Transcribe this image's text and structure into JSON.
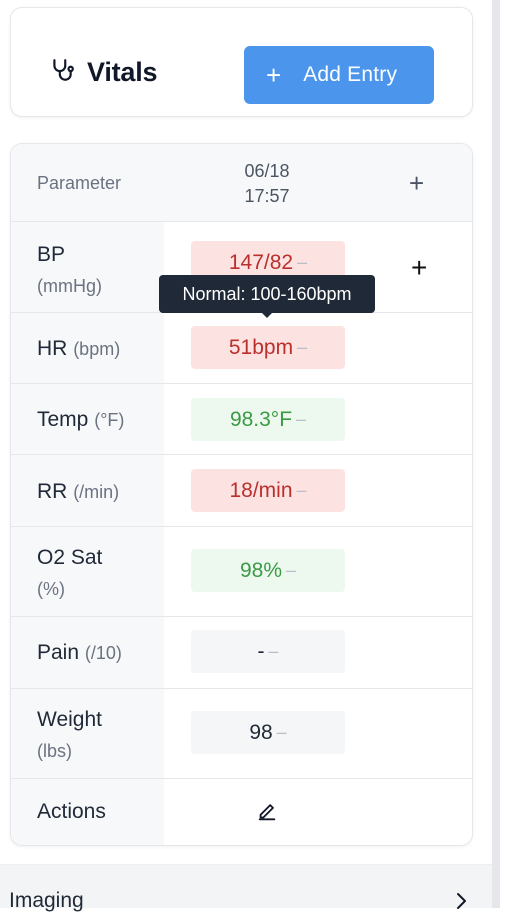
{
  "header": {
    "title": "Vitals",
    "icon": "stethoscope-icon",
    "add_button": {
      "plus": "+",
      "label": "Add Entry"
    }
  },
  "table": {
    "header": {
      "parameter": "Parameter",
      "date": "06/18",
      "time": "17:57",
      "add_column": "+"
    },
    "rows": [
      {
        "name": "BP",
        "unit": "(mmHg)",
        "value": "147/82",
        "status": "abnormal",
        "dash": "–",
        "action": "+"
      },
      {
        "name": "HR",
        "unit": "(bpm)",
        "value": "51bpm",
        "status": "abnormal",
        "dash": "–"
      },
      {
        "name": "Temp",
        "unit": "(°F)",
        "value": "98.3°F",
        "status": "normal",
        "dash": "–"
      },
      {
        "name": "RR",
        "unit": "(/min)",
        "value": "18/min",
        "status": "abnormal",
        "dash": "–"
      },
      {
        "name": "O2 Sat",
        "unit": "(%)",
        "value": "98%",
        "status": "normal",
        "dash": "–"
      },
      {
        "name": "Pain",
        "unit": "(/10)",
        "value": "-",
        "status": "none",
        "dash": "–"
      },
      {
        "name": "Weight",
        "unit": "(lbs)",
        "value": "98",
        "status": "none",
        "dash": "–"
      }
    ],
    "actions_label": "Actions",
    "actions_icon": "edit-pencil-icon"
  },
  "tooltip": {
    "text": "Normal: 100-160bpm"
  },
  "imaging": {
    "label": "Imaging"
  },
  "colors": {
    "accent": "#4b96ec",
    "abnormal_bg": "#fde2e2",
    "abnormal_text": "#b9302d",
    "normal_bg": "#edf9ee",
    "normal_text": "#3a9a46"
  }
}
